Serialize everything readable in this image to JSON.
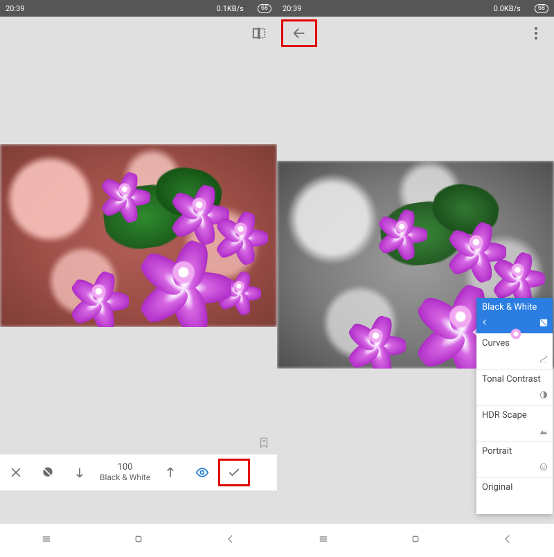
{
  "status": {
    "left": {
      "time": "20:39",
      "net": "0.1KB/s",
      "battery": "68"
    },
    "right": {
      "time": "20:39",
      "net": "0.0KB/s",
      "battery": "68"
    }
  },
  "left": {
    "editor": {
      "value": "100",
      "label": "Black & White"
    }
  },
  "right": {
    "effects": [
      {
        "label": "Black & White",
        "selected": true,
        "icon": "bw"
      },
      {
        "label": "Curves",
        "selected": false,
        "icon": "curves"
      },
      {
        "label": "Tonal Contrast",
        "selected": false,
        "icon": "contrast"
      },
      {
        "label": "HDR Scape",
        "selected": false,
        "icon": "hdr"
      },
      {
        "label": "Portrait",
        "selected": false,
        "icon": "portrait"
      },
      {
        "label": "Original",
        "selected": false,
        "icon": ""
      }
    ]
  },
  "colors": {
    "accent": "#2b7de1",
    "highlight": "#e00000"
  }
}
